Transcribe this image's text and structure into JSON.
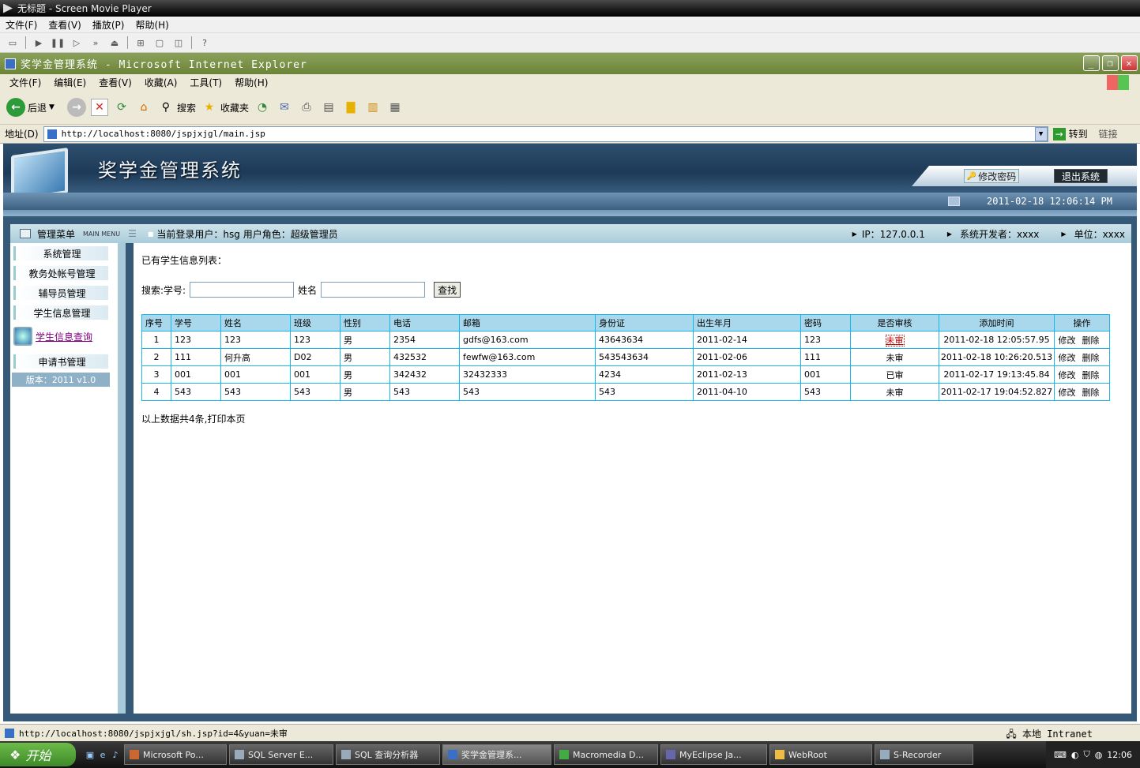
{
  "player": {
    "title": "无标题 - Screen Movie Player",
    "menu": [
      "文件(F)",
      "查看(V)",
      "播放(P)",
      "帮助(H)"
    ]
  },
  "ie": {
    "title": "奖学金管理系统 - Microsoft Internet Explorer",
    "menu": [
      "文件(F)",
      "编辑(E)",
      "查看(V)",
      "收藏(A)",
      "工具(T)",
      "帮助(H)"
    ],
    "toolbar": {
      "back": "后退",
      "search": "搜索",
      "favorites": "收藏夹"
    },
    "address_label": "地址(D)",
    "address": "http://localhost:8080/jspjxjgl/main.jsp",
    "go": "转到",
    "links": "链接",
    "status_url": "http://localhost:8080/jspjxjgl/sh.jsp?id=4&yuan=未审",
    "zone": "本地 Intranet"
  },
  "app": {
    "title": "奖学金管理系统",
    "change_password": "修改密码",
    "logout": "退出系统",
    "datetime": "2011-02-18 12:06:14 PM",
    "menu_label": "管理菜单",
    "menu_label_en": "MAIN MENU",
    "current_user": "当前登录用户：hsg  用户角色：超级管理员",
    "ip": "IP：127.0.0.1",
    "developer": "系统开发者：xxxx",
    "unit": "单位：xxxx"
  },
  "sidebar": {
    "items": [
      "系统管理",
      "教务处帐号管理",
      "辅导员管理",
      "学生信息管理",
      "申请书管理"
    ],
    "query_link": "学生信息查询",
    "version": "版本：2011 v1.0"
  },
  "content": {
    "list_title": "已有学生信息列表：",
    "search_label": "搜索:学号:",
    "name_label": "姓名",
    "search_button": "查找",
    "columns": [
      "序号",
      "学号",
      "姓名",
      "班级",
      "性别",
      "电话",
      "邮箱",
      "身份证",
      "出生年月",
      "密码",
      "是否审核",
      "添加时间",
      "操作"
    ],
    "rows": [
      {
        "no": "1",
        "sid": "123",
        "name": "123",
        "class": "123",
        "gender": "男",
        "phone": "2354",
        "email": "gdfs@163.com",
        "idcard": "43643634",
        "birth": "2011-02-14",
        "pwd": "123",
        "audit": "未审",
        "added": "2011-02-18 12:05:57.95"
      },
      {
        "no": "2",
        "sid": "111",
        "name": "何升高",
        "class": "D02",
        "gender": "男",
        "phone": "432532",
        "email": "fewfw@163.com",
        "idcard": "543543634",
        "birth": "2011-02-06",
        "pwd": "111",
        "audit": "未审",
        "added": "2011-02-18 10:26:20.513"
      },
      {
        "no": "3",
        "sid": "001",
        "name": "001",
        "class": "001",
        "gender": "男",
        "phone": "342432",
        "email": "32432333",
        "idcard": "4234",
        "birth": "2011-02-13",
        "pwd": "001",
        "audit": "已审",
        "added": "2011-02-17 19:13:45.84"
      },
      {
        "no": "4",
        "sid": "543",
        "name": "543",
        "class": "543",
        "gender": "男",
        "phone": "543",
        "email": "543",
        "idcard": "543",
        "birth": "2011-04-10",
        "pwd": "543",
        "audit": "未审",
        "added": "2011-02-17 19:04:52.827"
      }
    ],
    "edit": "修改",
    "delete": "删除",
    "footer": "以上数据共4条,打印本页"
  },
  "taskbar": {
    "start": "开始",
    "tasks": [
      "Microsoft Po...",
      "SQL Server E...",
      "SQL 查询分析器",
      "奖学金管理系...",
      "Macromedia D...",
      "MyEclipse Ja...",
      "WebRoot",
      "S-Recorder"
    ],
    "clock": "12:06"
  },
  "colors": {
    "table_header": "#a9d8ec",
    "table_border": "#1ab6e6",
    "audit_link": "#cc0000"
  }
}
